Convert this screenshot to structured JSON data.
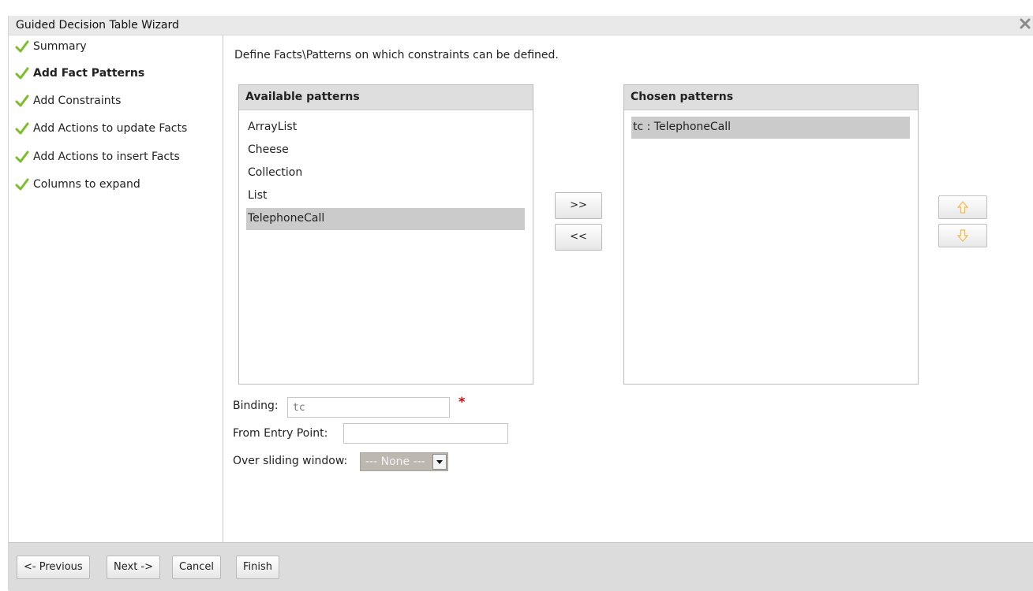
{
  "window": {
    "title": "Guided Decision Table Wizard"
  },
  "steps": [
    {
      "label": "Summary",
      "active": false
    },
    {
      "label": "Add Fact Patterns",
      "active": true
    },
    {
      "label": "Add Constraints",
      "active": false
    },
    {
      "label": "Add Actions to update Facts",
      "active": false
    },
    {
      "label": "Add Actions to insert Facts",
      "active": false
    },
    {
      "label": "Columns to expand",
      "active": false
    }
  ],
  "main": {
    "intro": "Define Facts\\Patterns on which constraints can be defined.",
    "available": {
      "header": "Available patterns",
      "items": [
        "ArrayList",
        "Cheese",
        "Collection",
        "List",
        "TelephoneCall"
      ],
      "selected": "TelephoneCall"
    },
    "chosen": {
      "header": "Chosen patterns",
      "items": [
        "tc : TelephoneCall"
      ],
      "selected": "tc : TelephoneCall"
    },
    "add_label": ">>",
    "remove_label": "<<",
    "binding_label": "Binding:",
    "binding_value": "tc",
    "required_mark": "*",
    "entry_point_label": "From Entry Point:",
    "entry_point_value": "",
    "window_label": "Over sliding window:",
    "window_value": "--- None ---"
  },
  "footer": {
    "previous": "<- Previous",
    "next": "Next ->",
    "cancel": "Cancel",
    "finish": "Finish"
  },
  "icons": {
    "check": "checkmark-icon",
    "close": "close-icon",
    "up": "arrow-up-icon",
    "down": "arrow-down-icon"
  },
  "colors": {
    "check": "#7cbd2b",
    "arrow": "#f0b040",
    "required": "#dd0000",
    "selection": "#cbcbcb"
  }
}
